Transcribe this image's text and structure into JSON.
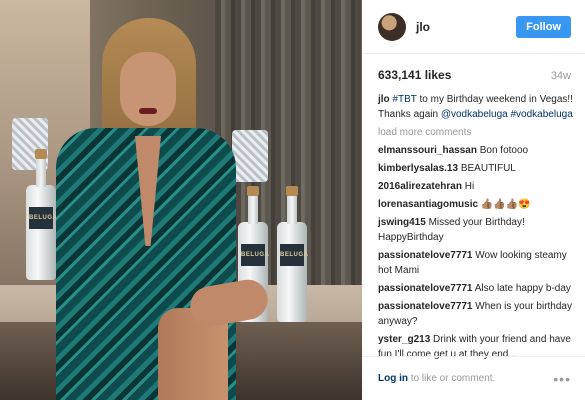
{
  "header": {
    "username": "jlo",
    "follow_label": "Follow"
  },
  "stats": {
    "likes": "633,141 likes",
    "time": "34w"
  },
  "caption": {
    "username": "jlo",
    "parts": [
      "#TBT",
      " to my Birthday weekend in Vegas!! Thanks again ",
      "@vodkabeluga",
      " ",
      "#vodkabeluga"
    ]
  },
  "load_more": "load more comments",
  "comments": [
    {
      "user": "elmanssouri_hassan",
      "text": "Bon fotooo"
    },
    {
      "user": "kimberlysalas.13",
      "text": "BEAUTIFUL"
    },
    {
      "user": "2016alirezatehran",
      "text": "Hi"
    },
    {
      "user": "lorenasantiagomusic",
      "text": "👍🏽👍🏽👍🏽😍"
    },
    {
      "user": "jswing415",
      "text": "Missed your Birthday! HappyBirthday"
    },
    {
      "user": "passionatelove7771",
      "text": "Wow looking steamy hot Mami"
    },
    {
      "user": "passionatelove7771",
      "text": "Also late happy b-day"
    },
    {
      "user": "passionatelove7771",
      "text": "When is your birthday anyway?"
    },
    {
      "user": "yster_g213",
      "text": "Drink with your friend and have fun I'll come get u at they end..."
    }
  ],
  "footer": {
    "login": "Log in",
    "text": " to like or comment.",
    "more_icon": "more-options-icon"
  },
  "photo": {
    "bottle_label": "BELUGA"
  },
  "colors": {
    "follow": "#3897f0",
    "link": "#003569",
    "muted": "#999999"
  }
}
